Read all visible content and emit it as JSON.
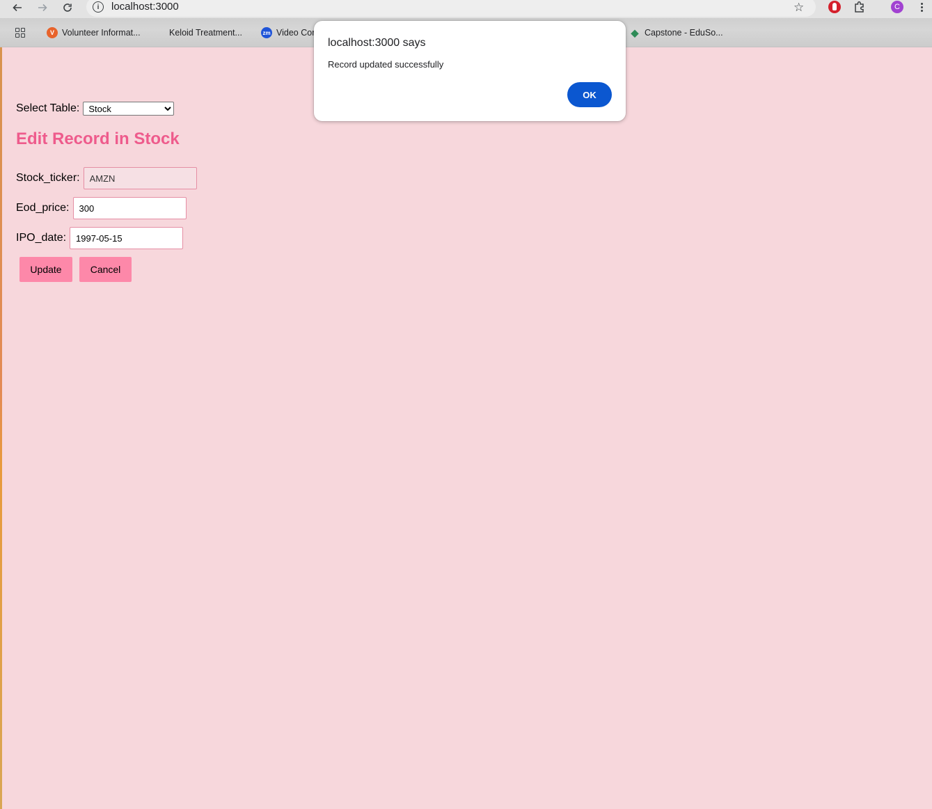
{
  "browser": {
    "url": "localhost:3000",
    "profile_initial": "C",
    "bookmarks": [
      {
        "label": "Volunteer Informat...",
        "icon": "v-logo-icon",
        "icon_text": "V"
      },
      {
        "label": "Keloid Treatment...",
        "icon": "grid-logo-icon",
        "icon_text": ""
      },
      {
        "label": "Video Cor",
        "icon": "zoom-logo-icon",
        "icon_text": "zm"
      },
      {
        "label": "Capstone - EduSo...",
        "icon": "capstone-logo-icon",
        "icon_text": ""
      }
    ]
  },
  "page": {
    "select_label": "Select Table:",
    "select_value": "Stock",
    "heading": "Edit Record in Stock",
    "fields": [
      {
        "label": "Stock_ticker:",
        "value": "AMZN",
        "readonly": true
      },
      {
        "label": "Eod_price:",
        "value": "300",
        "readonly": false
      },
      {
        "label": "IPO_date:",
        "value": "1997-05-15",
        "readonly": false
      }
    ],
    "buttons": {
      "update": "Update",
      "cancel": "Cancel"
    }
  },
  "dialog": {
    "title": "localhost:3000 says",
    "message": "Record updated successfully",
    "ok": "OK"
  },
  "colors": {
    "page_background": "#f7d7dc",
    "heading": "#ee5b8c",
    "button": "#fd88a9",
    "dialog_ok": "#0b57d0"
  }
}
